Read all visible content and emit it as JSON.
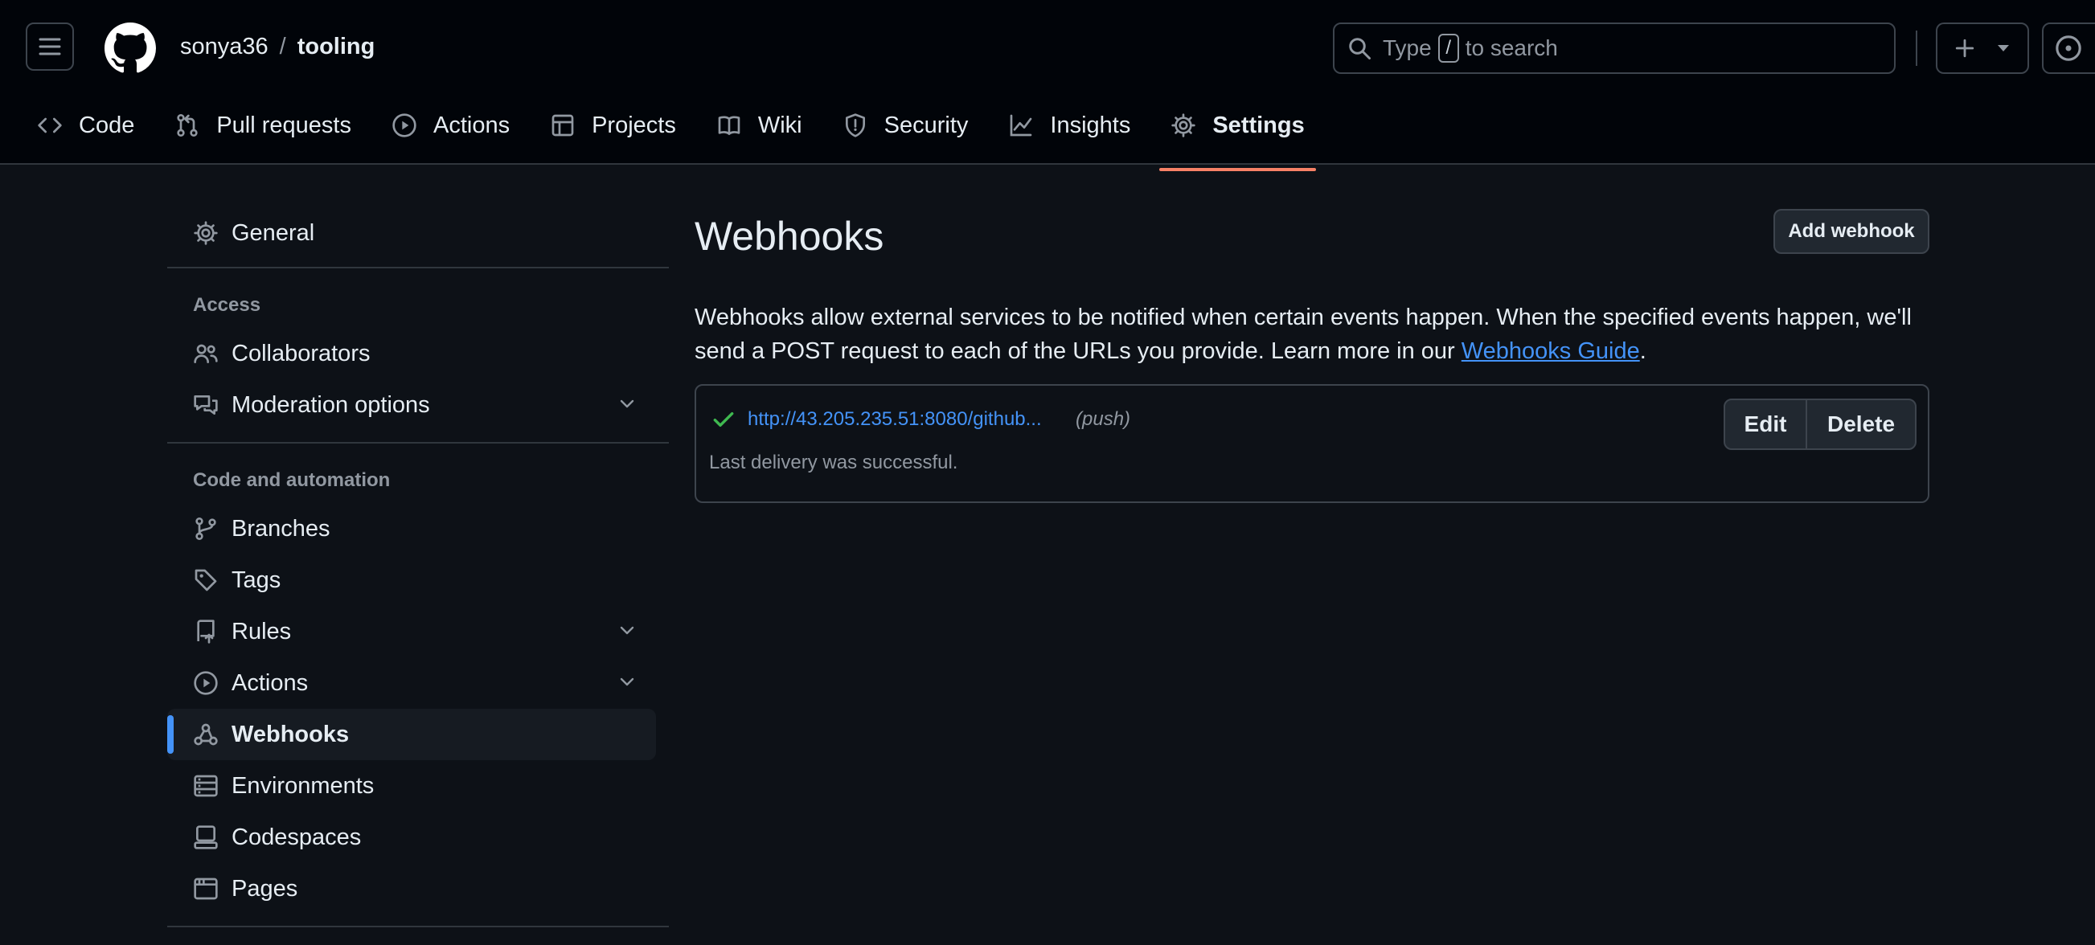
{
  "header": {
    "owner": "sonya36",
    "separator": "/",
    "repo": "tooling",
    "search": {
      "before": "Type",
      "key": "/",
      "after": "to search"
    },
    "icons": [
      "hamburger-icon",
      "github-logo",
      "search-icon",
      "plus-icon",
      "triangle-down-icon",
      "issue-opened-icon"
    ]
  },
  "repo_tabs": [
    {
      "label": "Code",
      "icon": "code-icon"
    },
    {
      "label": "Pull requests",
      "icon": "git-pull-request-icon"
    },
    {
      "label": "Actions",
      "icon": "play-icon"
    },
    {
      "label": "Projects",
      "icon": "table-icon"
    },
    {
      "label": "Wiki",
      "icon": "book-icon"
    },
    {
      "label": "Security",
      "icon": "shield-icon"
    },
    {
      "label": "Insights",
      "icon": "graph-icon"
    },
    {
      "label": "Settings",
      "icon": "gear-icon",
      "active": true
    }
  ],
  "sidebar": {
    "general": "General",
    "access_heading": "Access",
    "access_items": [
      "Collaborators",
      "Moderation options"
    ],
    "code_heading": "Code and automation",
    "code_items": [
      "Branches",
      "Tags",
      "Rules",
      "Actions",
      "Webhooks",
      "Environments",
      "Codespaces",
      "Pages"
    ],
    "selected": "Webhooks"
  },
  "main": {
    "title": "Webhooks",
    "add_button": "Add webhook",
    "desc_text": "Webhooks allow external services to be notified when certain events happen. When the specified events happen, we'll send a POST request to each of the URLs you provide. Learn more in our ",
    "desc_link": "Webhooks Guide",
    "desc_end": ".",
    "hook": {
      "url": "http://43.205.235.51:8080/github...",
      "events": "(push)",
      "status": "Last delivery was successful.",
      "edit": "Edit",
      "delete": "Delete"
    }
  },
  "colors": {
    "background": "#0d1117",
    "header": "#010409",
    "accent_link": "#4493f8",
    "active_tab": "#f78166",
    "success": "#3fb950"
  }
}
